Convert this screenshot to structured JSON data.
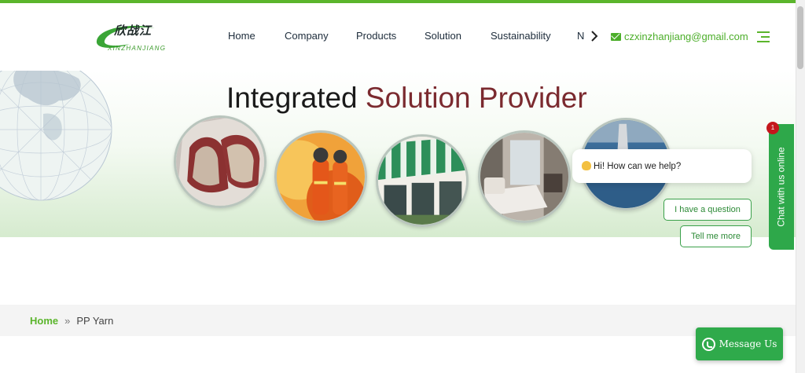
{
  "header": {
    "logo_cn": "欣战江",
    "logo_en": "XINZHANJIANG",
    "nav": [
      "Home",
      "Company",
      "Products",
      "Solution",
      "Sustainability",
      "N"
    ],
    "email": "czxinzhanjiang@gmail.com"
  },
  "banner": {
    "title_part1": "Integrated ",
    "title_part2": "Solution Provider"
  },
  "chat": {
    "greeting": "Hi! How can we help?",
    "options": [
      "I have a question",
      "Tell me more"
    ],
    "tab_label": "Chat with us online",
    "badge": "1"
  },
  "breadcrumb": {
    "home": "Home",
    "separator": "»",
    "current": "PP Yarn"
  },
  "whatsapp": {
    "label": "Message Us"
  },
  "colors": {
    "brand_green": "#5bb52c",
    "title_accent": "#7b2a2f",
    "chat_green": "#2ea84a"
  }
}
